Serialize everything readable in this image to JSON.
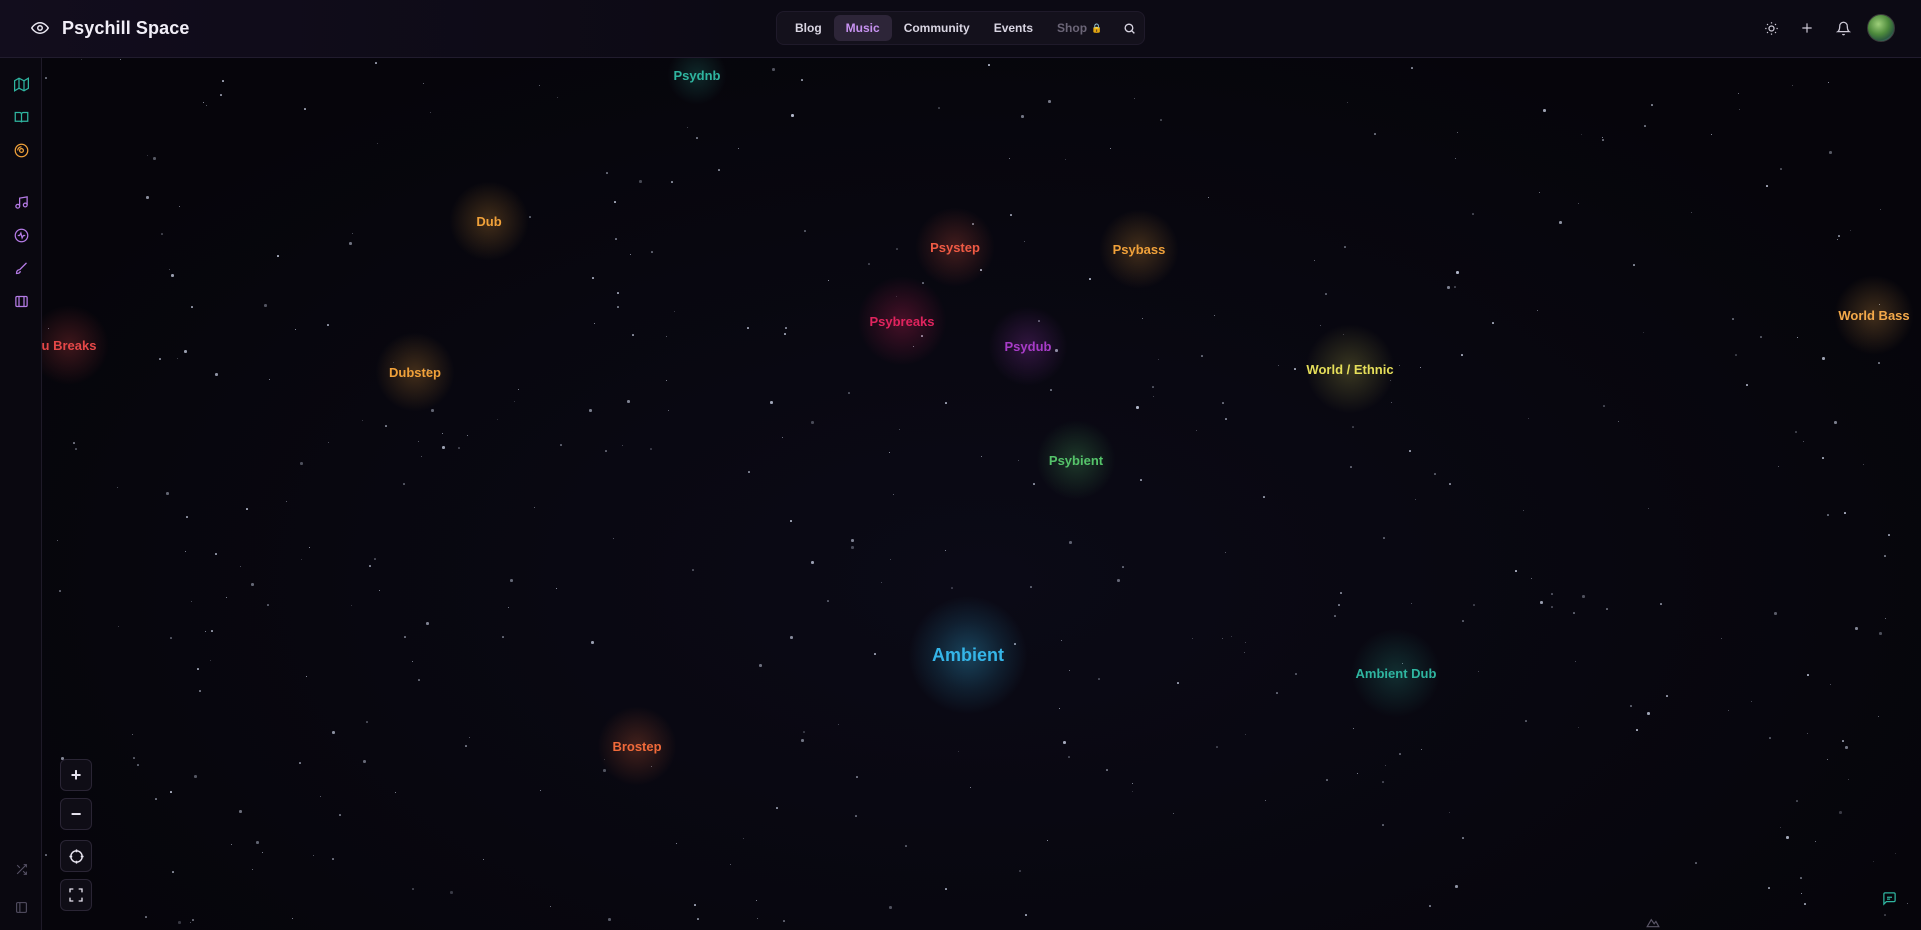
{
  "app": {
    "title": "Psychill Space"
  },
  "nav": {
    "tabs": [
      {
        "label": "Blog",
        "active": false
      },
      {
        "label": "Music",
        "active": true
      },
      {
        "label": "Community",
        "active": false
      },
      {
        "label": "Events",
        "active": false
      },
      {
        "label": "Shop",
        "active": false,
        "disabled": true
      }
    ]
  },
  "header_icons": [
    "theme-sun-icon",
    "plus-icon",
    "bell-icon",
    "avatar"
  ],
  "sidebar_icons": [
    "map-icon",
    "book-icon",
    "vinyl-icon",
    "music-note-icon",
    "radio-icon",
    "brush-icon",
    "library-icon",
    "shuffle-icon",
    "panel-icon"
  ],
  "map": {
    "genres": [
      {
        "label": "Psydnb",
        "color": "#2fb5a0"
      },
      {
        "label": "Dub",
        "color": "#f0a13a"
      },
      {
        "label": "Psystep",
        "color": "#ef5a44"
      },
      {
        "label": "Psybass",
        "color": "#f0a13a"
      },
      {
        "label": "World Bass",
        "color": "#f3a94a"
      },
      {
        "label": "u Breaks",
        "color": "#e54848"
      },
      {
        "label": "Psybreaks",
        "color": "#e0245e"
      },
      {
        "label": "Psydub",
        "color": "#a83cc8"
      },
      {
        "label": "Dubstep",
        "color": "#f0a13a"
      },
      {
        "label": "World / Ethnic",
        "color": "#e6df5a"
      },
      {
        "label": "Psybient",
        "color": "#55c36a"
      },
      {
        "label": "Ambient",
        "color": "#35b5e8"
      },
      {
        "label": "Ambient Dub",
        "color": "#2fb5a0"
      },
      {
        "label": "Brostep",
        "color": "#f06a3a"
      }
    ]
  },
  "controls": {
    "zoom_in": "+",
    "zoom_out": "−"
  },
  "colors": {
    "accent": "#c792f0",
    "background": "#07060d"
  }
}
